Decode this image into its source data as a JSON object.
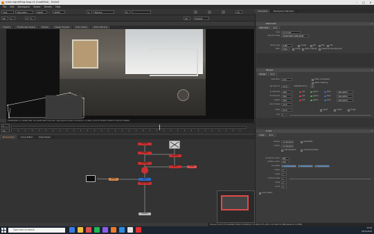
{
  "window": {
    "title": "nuke-vignetting-loop.nk (modified) - NukeX",
    "min": "–",
    "max": "□",
    "close": "×"
  },
  "menu": [
    "File",
    "Edit",
    "Workspace",
    "Viewer",
    "Render",
    "Help"
  ],
  "viewer_toolbar": {
    "layer": "rgba",
    "channel": "rgba.alpha",
    "colorspace": "sRGB",
    "zoom": "v8385",
    "input_a": "A",
    "input_node": "Merge1",
    "input_b": "B",
    "b_none": "-",
    "lock_label": "2D"
  },
  "viewer_toolbar2": {
    "fstop": "f/8",
    "fstop_val": "1",
    "gamma_label": "Y",
    "gamma_val": "1",
    "proxy": "2D",
    "frame_label": "Default"
  },
  "viewer_tabs": [
    "Viewer1",
    "Thumbnails Viewer",
    "Tracker",
    "Viewer Preview",
    "Roto Viewer",
    "Zoom Window"
  ],
  "viewer_status": "2448x2048 1:1 (2048)   Stat: 0:0 2448 2048 channels: rgba,depth,forward.u,forward.v        x=480 y=412   0.35169  0.34932  0.35215  0.00000",
  "timeline": {
    "frame": "1",
    "fps": "24",
    "start": "1",
    "end": "100",
    "mode": "Global"
  },
  "nodegraph_tabs": [
    {
      "label": "Node Graph",
      "active": true
    },
    {
      "label": "Curve Editor",
      "active": false
    },
    {
      "label": "Dope Sheet",
      "active": false
    }
  ],
  "nodes": [
    {
      "name": "Read1",
      "color": "#8e8e8e"
    },
    {
      "name": "Write2",
      "color": "#e08844"
    },
    {
      "name": "Transform1",
      "color": "#8ea4d4"
    },
    {
      "name": "Blur1",
      "color": "#cc3030"
    },
    {
      "name": "Grade1",
      "color": "#cc3030"
    },
    {
      "name": "Merge1",
      "color": "#cc3030"
    },
    {
      "name": "Merge2",
      "color": "#cc3030"
    },
    {
      "name": "Shuffle1",
      "color": "#cc3030"
    },
    {
      "name": "Reformat1",
      "color": "#cc3030"
    },
    {
      "name": "Viewer1",
      "color": "#bbbbbb"
    },
    {
      "name": "Dot1",
      "color": "#2a6bd0"
    },
    {
      "name": "Dot2",
      "color": "#cc3030"
    },
    {
      "name": "Crop1",
      "color": "#e04e4e"
    }
  ],
  "properties": {
    "tabs": [
      {
        "label": "Properties",
        "active": true
      },
      {
        "label": "Background Renders",
        "active": false
      }
    ],
    "reformat": {
      "title": "Reformat1",
      "tabs": [
        "Reformat",
        "Node"
      ],
      "type_label": "type",
      "type_val": "to format",
      "outfmt_label": "output format",
      "outfmt_val": "2448x2048 2448x2048",
      "resize_label": "resize type",
      "resize_val": "width",
      "center": "center",
      "flip": "flip",
      "flop": "flop",
      "turn": "turn",
      "filter_label": "filter",
      "filter_val": "Cubic",
      "clamp": "clamp",
      "black_outside": "black outside",
      "preserve": "preserve bounding box"
    },
    "merge": {
      "title": "Merge1",
      "tabs": [
        "Merge",
        "Node"
      ],
      "operation_label": "operation",
      "operation_val": "over",
      "video_colorspace": "Video colorspace",
      "alpha_masking": "alpha masking",
      "bbox_label": "set bbox to",
      "bbox_val": "union",
      "metadata_label": "metadata from",
      "metadata_val": "B",
      "achan_label": "A channels",
      "achan_val": "rgba",
      "bchan_label": "B channels",
      "bchan_val": "rgba",
      "output_label": "output",
      "output_val": "rgba",
      "red": "red",
      "green": "green",
      "blue": "blue",
      "alpha_a": "rgba.alpha",
      "alpha_b": "rgba.alpha",
      "alpha_out": "rgba.alpha",
      "also_label": "also merge",
      "also_val": "none",
      "mask_label": "mask",
      "mask_val": "none",
      "inject": "inject",
      "invert": "invert",
      "fringe": "fringe",
      "mix_label": "mix",
      "mix_val": "1"
    },
    "crop": {
      "title": "Crop1",
      "tabs": [
        "Crop",
        "Node"
      ],
      "display_label": "display",
      "display_val": "unchanged",
      "render_label": "render",
      "render_val": "unchanged",
      "selectable": "selectable",
      "shadows": "cast shadows",
      "receive": "receive shadows",
      "order_label": "transform order",
      "order_val": "SRT",
      "rot_label": "rotation order",
      "rot_val": "ZXY",
      "translate_label": "translate",
      "translate_x": "0",
      "translate_y": "0",
      "translate_z": "0",
      "rotate_label": "rotate",
      "rotate_val": "0",
      "scale_label": "scale",
      "scale_val": "1",
      "uniform_label": "uniform scale",
      "uniform_val": "1",
      "skew_label": "skew",
      "skew_val": "0",
      "pivot_label": "pivot",
      "pivot_val": "0",
      "local_matrix": "local matrix"
    }
  },
  "status_bar": "Channel Count: 23  Localization Mode: On  Memory: 1.4 GB (11.3%)  CPU: 1.4%  Disk: 0.0 MB/s  Network: 0.0 MB/s",
  "taskbar": {
    "search": "Type here to search",
    "time": "10:18",
    "date": "20/11/2019",
    "apps": [
      "#3a7ae0",
      "#f0c040",
      "#e04e4e",
      "#1db954",
      "#8a5cf0",
      "#ec7a2a",
      "#2a8ce0",
      "#e2e2e2",
      "#e03030"
    ]
  }
}
